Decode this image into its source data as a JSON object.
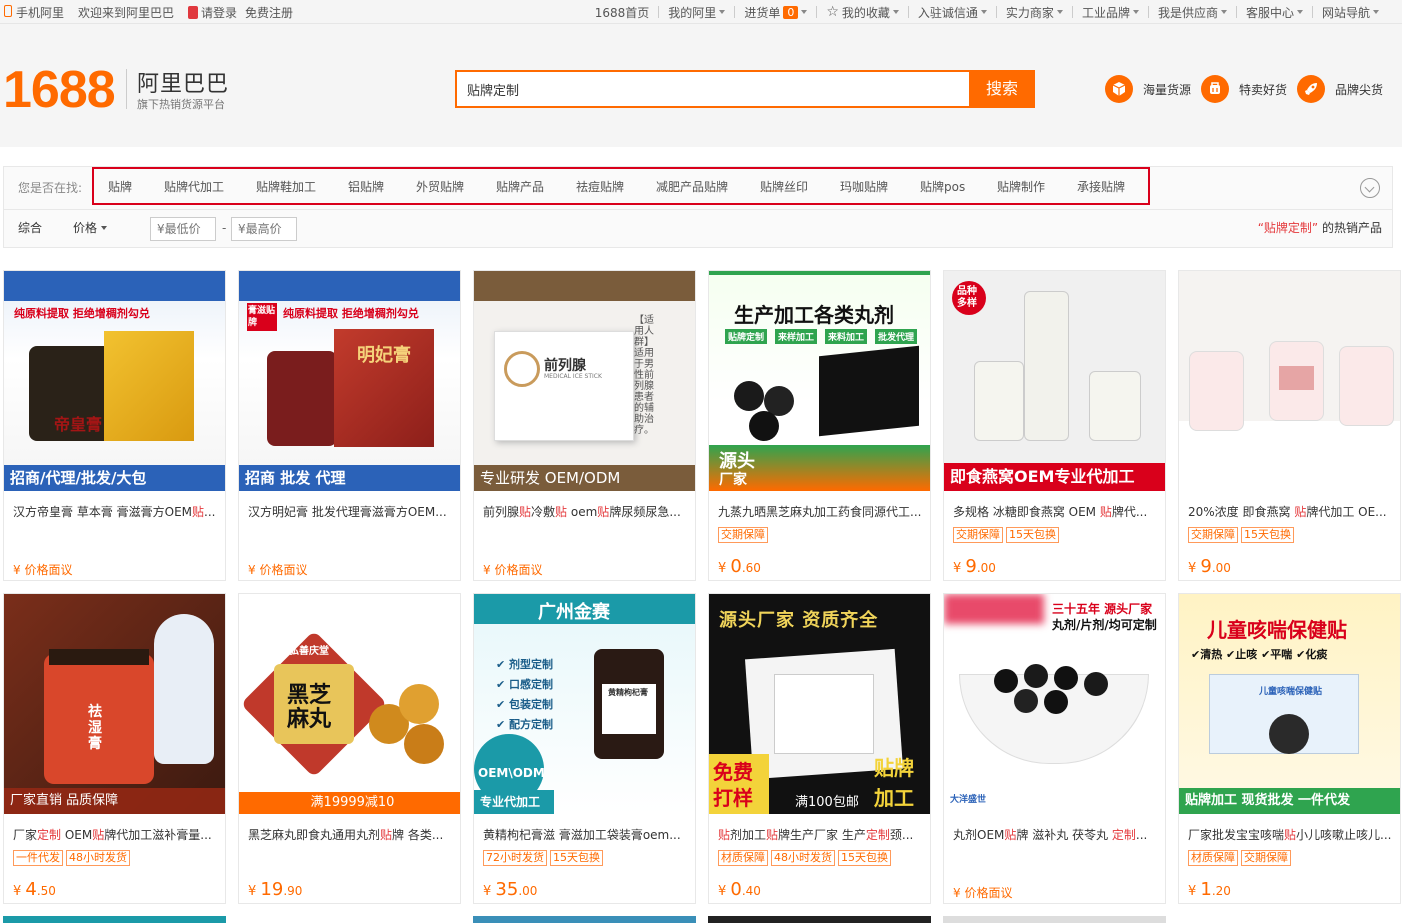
{
  "topbar": {
    "left": [
      "手机阿里",
      "欢迎来到阿里巴巴",
      "请登录",
      "免费注册"
    ],
    "nav": [
      {
        "label": "1688首页",
        "caret": false
      },
      {
        "label": "我的阿里",
        "caret": true
      },
      {
        "label": "进货单",
        "caret": true,
        "badge": "0"
      },
      {
        "label": "我的收藏",
        "caret": true
      },
      {
        "label": "入驻诚信通",
        "caret": true
      },
      {
        "label": "实力商家",
        "caret": true
      },
      {
        "label": "工业品牌",
        "caret": true
      },
      {
        "label": "我是供应商",
        "caret": true
      },
      {
        "label": "客服中心",
        "caret": true
      },
      {
        "label": "网站导航",
        "caret": true
      }
    ]
  },
  "header": {
    "logo_number": "1688",
    "logo_name": "阿里巴巴",
    "logo_slogan": "旗下热销货源平台",
    "search_value": "贴牌定制",
    "search_button": "搜索",
    "features": [
      "海量货源",
      "特卖好货",
      "品牌尖货"
    ]
  },
  "suggest": {
    "label": "您是否在找:",
    "items": [
      "贴牌",
      "贴牌代加工",
      "贴牌鞋加工",
      "铝贴牌",
      "外贸贴牌",
      "贴牌产品",
      "祛痘贴牌",
      "减肥产品贴牌",
      "贴牌丝印",
      "玛咖贴牌",
      "贴牌pos",
      "贴牌制作",
      "承接贴牌"
    ]
  },
  "sort": {
    "overall": "综合",
    "price": "价格",
    "min_placeholder": "¥最低价",
    "max_placeholder": "¥最高价",
    "dash": "-",
    "hot_keyword": "“贴牌定制”",
    "hot_suffix": "的热销产品"
  },
  "products": [
    {
      "title": "汉方帝皇膏 草本膏 膏滋膏方OEM贴...",
      "tags": [],
      "price_int": "",
      "price_dec": "",
      "price_text": "¥ 价格面议",
      "img_texts": [
        "纯原料提取  拒绝增稠剂勾兑",
        "帝皇膏",
        "招商/代理/批发/大包"
      ]
    },
    {
      "title": "汉方明妃膏 批发代理膏滋膏方OEM...",
      "tags": [],
      "price_int": "",
      "price_dec": "",
      "price_text": "¥ 价格面议",
      "img_texts": [
        "膏滋贴牌",
        "纯原料提取  拒绝增稠剂勾兑",
        "明妃膏",
        "招商  批发  代理"
      ]
    },
    {
      "title": "前列腺贴冷敷贴 oem贴牌尿频尿急...",
      "tags": [],
      "price_int": "",
      "price_dec": "",
      "price_text": "¥ 价格面议",
      "img_texts": [
        "前列腺",
        "MEDICAL ICE STICK",
        "【适用人群】适用于男性前列腺患者的辅助治疗。",
        "专业研发   OEM/ODM"
      ]
    },
    {
      "title": "九蒸九晒黑芝麻丸加工药食同源代工...",
      "tags": [
        "交期保障"
      ],
      "price_int": "0",
      "price_dec": ".60",
      "price_text": "",
      "img_texts": [
        "生产加工各类丸剂",
        "贴牌定制",
        "来样加工",
        "来料加工",
        "批发代理",
        "源头",
        "厂家"
      ]
    },
    {
      "title": "多规格 冰糖即食燕窝 OEM 贴牌代...",
      "tags": [
        "交期保障",
        "15天包换"
      ],
      "price_int": "9",
      "price_dec": ".00",
      "price_text": "",
      "img_texts": [
        "品种多样",
        "即食燕窝OEM专业代加工"
      ]
    },
    {
      "title": "20%浓度 即食燕窝 贴牌代加工 OE...",
      "tags": [
        "交期保障",
        "15天包换"
      ],
      "price_int": "9",
      "price_dec": ".00",
      "price_text": "",
      "img_texts": []
    },
    {
      "title": "厂家定制 OEM贴牌代加工滋补膏量...",
      "tags": [
        "一件代发",
        "48小时发货"
      ],
      "price_int": "4",
      "price_dec": ".50",
      "price_text": "",
      "img_texts": [
        "祛湿膏",
        "厂家直销  品质保障"
      ]
    },
    {
      "title": "黑芝麻丸即食丸通用丸剂贴牌 各类...",
      "tags": [],
      "price_int": "19",
      "price_dec": ".90",
      "price_text": "",
      "img_texts": [
        "弘善庆堂",
        "黑芝麻丸",
        "满19999减10"
      ]
    },
    {
      "title": "黄精枸杞膏滋 膏滋加工袋装膏oem...",
      "tags": [
        "72小时发货",
        "15天包换"
      ],
      "price_int": "35",
      "price_dec": ".00",
      "price_text": "",
      "img_texts": [
        "广州金赛",
        "剂型定制",
        "口感定制",
        "包装定制",
        "配方定制",
        "黄精枸杞膏",
        "OEM\\ODM",
        "专业代加工"
      ]
    },
    {
      "title": "贴剂加工贴牌生产厂家 生产定制颈...",
      "tags": [
        "材质保障",
        "48小时发货",
        "15天包换"
      ],
      "price_int": "0",
      "price_dec": ".40",
      "price_text": "",
      "img_texts": [
        "源头厂家  资质齐全",
        "免费",
        "打样",
        "贴牌",
        "加工",
        "满100包邮"
      ]
    },
    {
      "title": "丸剂OEM贴牌 滋补丸 茯苓丸 定制...",
      "tags": [],
      "price_int": "",
      "price_dec": "",
      "price_text": "¥ 价格面议",
      "img_texts": [
        "三十五年 源头厂家",
        "丸剂/片剂/均可定制",
        "大洋盛世"
      ]
    },
    {
      "title": "厂家批发宝宝咳喘贴小儿咳嗽止咳儿...",
      "tags": [
        "材质保障",
        "交期保障"
      ],
      "price_int": "1",
      "price_dec": ".20",
      "price_text": "",
      "img_texts": [
        "儿童咳喘保健贴",
        "清热",
        "止咳",
        "平喘",
        "化痰",
        "儿童咳喘保健贴",
        "贴牌加工  现货批发  一件代发"
      ]
    }
  ],
  "colors": {
    "brand": "#ff6a00",
    "highlight": "#e4393c",
    "suggest_border": "#d9001b"
  }
}
